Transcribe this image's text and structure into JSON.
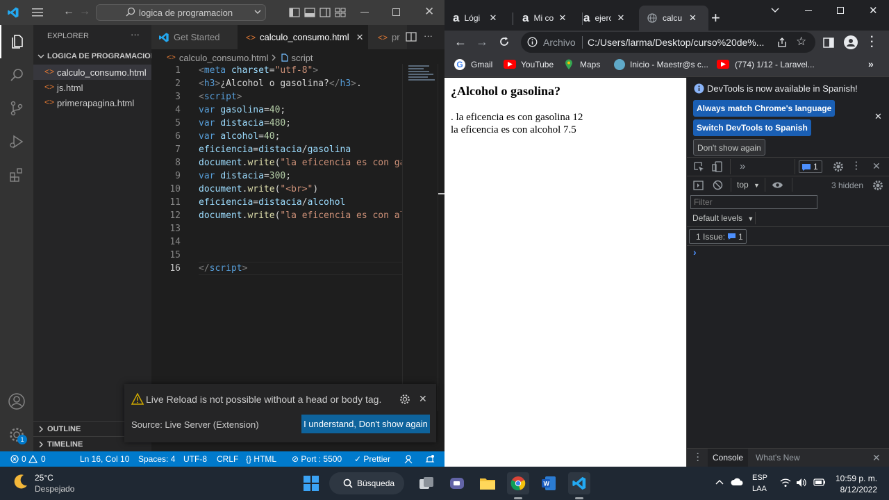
{
  "vscode": {
    "command_center": "logica de programacion",
    "explorer_title": "EXPLORER",
    "more": "···",
    "folder": "LOGICA DE PROGRAMACION",
    "files": [
      "calculo_consumo.html",
      "js.html",
      "primerapagina.html"
    ],
    "outline": "OUTLINE",
    "timeline": "TIMELINE",
    "settings_badge": "1",
    "tabs": [
      {
        "label": "Get Started"
      },
      {
        "label": "calculo_consumo.html"
      },
      {
        "label": "pr"
      }
    ],
    "breadcrumb": {
      "file": "calculo_consumo.html",
      "symbol": "script"
    },
    "code": [
      {
        "n": "1",
        "tokens": [
          [
            "tag",
            "<"
          ],
          [
            "tn",
            "meta"
          ],
          [
            "txt",
            " "
          ],
          [
            "attr",
            "charset"
          ],
          [
            "txt",
            "="
          ],
          [
            "str",
            "\"utf-8\""
          ],
          [
            "tag",
            ">"
          ]
        ]
      },
      {
        "n": "2",
        "tokens": [
          [
            "tag",
            "<"
          ],
          [
            "tn",
            "h3"
          ],
          [
            "tag",
            ">"
          ],
          [
            "txt",
            "¿Alcohol o gasolina?"
          ],
          [
            "tag",
            "</"
          ],
          [
            "tn",
            "h3"
          ],
          [
            "tag",
            ">"
          ],
          [
            "txt",
            "."
          ]
        ]
      },
      {
        "n": "3",
        "tokens": [
          [
            "tag",
            "<"
          ],
          [
            "tn",
            "script"
          ],
          [
            "tag",
            ">"
          ]
        ]
      },
      {
        "n": "4",
        "tokens": [
          [
            "kw",
            "var"
          ],
          [
            "txt",
            " "
          ],
          [
            "var",
            "gasolina"
          ],
          [
            "txt",
            "="
          ],
          [
            "num",
            "40"
          ],
          [
            "txt",
            ";"
          ]
        ]
      },
      {
        "n": "5",
        "tokens": [
          [
            "kw",
            "var"
          ],
          [
            "txt",
            " "
          ],
          [
            "var",
            "distacia"
          ],
          [
            "txt",
            "="
          ],
          [
            "num",
            "480"
          ],
          [
            "txt",
            ";"
          ]
        ]
      },
      {
        "n": "6",
        "tokens": [
          [
            "kw",
            "var"
          ],
          [
            "txt",
            " "
          ],
          [
            "var",
            "alcohol"
          ],
          [
            "txt",
            "="
          ],
          [
            "num",
            "40"
          ],
          [
            "txt",
            ";"
          ]
        ]
      },
      {
        "n": "7",
        "tokens": [
          [
            "var",
            "eficiencia"
          ],
          [
            "txt",
            "="
          ],
          [
            "var",
            "distacia"
          ],
          [
            "txt",
            "/"
          ],
          [
            "var",
            "gasolina"
          ]
        ]
      },
      {
        "n": "8",
        "tokens": [
          [
            "var",
            "document"
          ],
          [
            "txt",
            "."
          ],
          [
            "fn",
            "write"
          ],
          [
            "txt",
            "("
          ],
          [
            "str",
            "\"la eficencia es con ga"
          ]
        ]
      },
      {
        "n": "9",
        "tokens": [
          [
            "kw",
            "var"
          ],
          [
            "txt",
            " "
          ],
          [
            "var",
            "distacia"
          ],
          [
            "txt",
            "="
          ],
          [
            "num",
            "300"
          ],
          [
            "txt",
            ";"
          ]
        ]
      },
      {
        "n": "10",
        "tokens": [
          [
            "var",
            "document"
          ],
          [
            "txt",
            "."
          ],
          [
            "fn",
            "write"
          ],
          [
            "txt",
            "("
          ],
          [
            "str",
            "\"<br>\""
          ],
          [
            "txt",
            ")"
          ]
        ]
      },
      {
        "n": "11",
        "tokens": [
          [
            "var",
            "eficiencia"
          ],
          [
            "txt",
            "="
          ],
          [
            "var",
            "distacia"
          ],
          [
            "txt",
            "/"
          ],
          [
            "var",
            "alcohol"
          ]
        ]
      },
      {
        "n": "12",
        "tokens": [
          [
            "var",
            "document"
          ],
          [
            "txt",
            "."
          ],
          [
            "fn",
            "write"
          ],
          [
            "txt",
            "("
          ],
          [
            "str",
            "\"la eficencia es con al"
          ]
        ]
      },
      {
        "n": "13",
        "tokens": []
      },
      {
        "n": "14",
        "tokens": []
      },
      {
        "n": "15",
        "tokens": []
      },
      {
        "n": "16",
        "tokens": [
          [
            "tag",
            "</"
          ],
          [
            "tn",
            "script"
          ],
          [
            "tag",
            ">"
          ]
        ]
      }
    ],
    "notification": {
      "message": "Live Reload is not possible without a head or body tag.",
      "source": "Source: Live Server (Extension)",
      "button": "I understand, Don't show again"
    },
    "status": {
      "errors": "0",
      "warnings": "0",
      "position": "Ln 16, Col 10",
      "spaces": "Spaces: 4",
      "encoding": "UTF-8",
      "eol": "CRLF",
      "language": "HTML",
      "port": "Port : 5500",
      "prettier": "Prettier"
    }
  },
  "chrome": {
    "tabs": [
      {
        "label": "Lógi"
      },
      {
        "label": "Mi co"
      },
      {
        "label": "ejerc"
      },
      {
        "label": "calcu"
      }
    ],
    "address_prefix": "Archivo",
    "address": "C:/Users/larma/Desktop/curso%20de%...",
    "bookmarks": [
      "Gmail",
      "YouTube",
      "Maps",
      "Inicio - Maestr@s c...",
      "(774) 1/12 - Laravel..."
    ],
    "page": {
      "heading": "¿Alcohol o gasolina?",
      "line1": ". la eficencia es con gasolina 12",
      "line2": "la eficencia es con alcohol 7.5"
    },
    "devtools": {
      "banner": "DevTools is now available in Spanish!",
      "btn_match": "Always match Chrome's language",
      "btn_switch": "Switch DevTools to Spanish",
      "btn_dont": "Don't show again",
      "issues_badge": "1",
      "context": "top",
      "hidden": "3 hidden",
      "filter_placeholder": "Filter",
      "levels": "Default levels",
      "issue_label": "1 Issue:",
      "issue_count": "1",
      "prompt": "›",
      "drawer_console": "Console",
      "drawer_whatsnew": "What's New"
    }
  },
  "taskbar": {
    "temp": "25°C",
    "weather": "Despejado",
    "search": "Búsqueda",
    "lang_top": "ESP",
    "lang_bottom": "LAA",
    "time": "10:59 p. m.",
    "date": "8/12/2022"
  }
}
